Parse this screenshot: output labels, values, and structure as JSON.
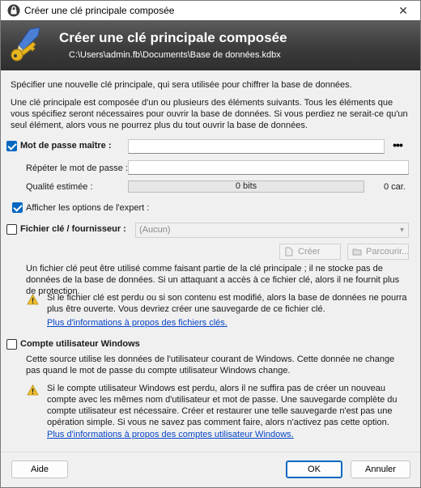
{
  "window": {
    "title": "Créer une clé principale composée",
    "close_glyph": "✕"
  },
  "banner": {
    "title": "Créer une clé principale composée",
    "path": "C:\\Users\\admin.fb\\Documents\\Base de données.kdbx"
  },
  "intro": {
    "line1": "Spécifier une nouvelle clé principale, qui sera utilisée pour chiffrer la base de données.",
    "line2": "Une clé principale est composée d'un ou plusieurs des éléments suivants. Tous les éléments que vous spécifiez seront nécessaires pour ouvrir la base de données. Si vous perdiez ne serait-ce qu'un seul élément, alors vous ne pourrez plus du tout ouvrir la base de données."
  },
  "password": {
    "checked": true,
    "label": "Mot de passe maître :",
    "value": "",
    "reveal_label": "•••",
    "repeat_label": "Répéter le mot de passe :",
    "repeat_value": "",
    "quality_label": "Qualité estimée :",
    "quality_bits": "0 bits",
    "quality_chars": "0 car."
  },
  "expert": {
    "checked": true,
    "label": "Afficher les options de l'expert :"
  },
  "keyfile": {
    "checked": false,
    "label": "Fichier clé / fournisseur :",
    "selected": "(Aucun)",
    "create_label": "Créer",
    "browse_label": "Parcourir...",
    "description": "Un fichier clé peut être utilisé comme faisant partie de la clé principale ; il ne stocke pas de données de la base de données. Si un attaquant a accès à ce fichier clé, alors il ne fournit plus de protection.",
    "warning": "Si le fichier clé est perdu ou si son contenu est modifié, alors la base de données ne pourra plus être ouverte. Vous devriez créer une sauvegarde de ce fichier clé.",
    "link": "Plus d'informations à propos des fichiers clés."
  },
  "winaccount": {
    "checked": false,
    "label": "Compte utilisateur Windows",
    "description": "Cette source utilise les données de l'utilisateur courant de Windows. Cette donnée ne change pas quand le mot de passe du compte utilisateur Windows change.",
    "warning": "Si le compte utilisateur Windows est perdu, alors il ne suffira pas de créer un nouveau compte avec les mêmes nom d'utilisateur et mot de passe. Une sauvegarde complète du compte utilisateur est nécessaire. Créer et restaurer une telle sauvegarde n'est pas une opération simple. Si vous ne savez pas comment faire, alors n'activez pas cette option.",
    "link": "Plus d'informations à propos des comptes utilisateur Windows."
  },
  "footer": {
    "help_label": "Aide",
    "ok_label": "OK",
    "cancel_label": "Annuler"
  },
  "colors": {
    "accent": "#0067c0",
    "link": "#0645c8",
    "banner_dark": "#2e2e2e",
    "warning_yellow": "#f2c12e"
  }
}
